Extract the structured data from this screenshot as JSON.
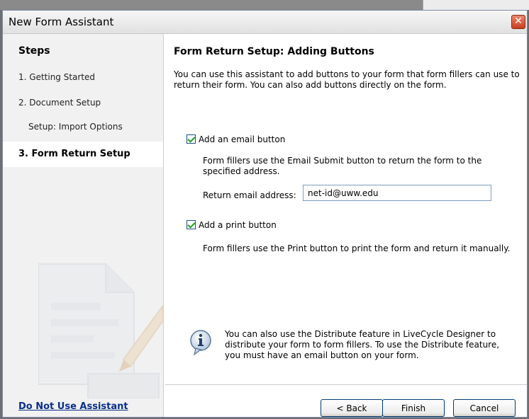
{
  "window": {
    "title": "New Form Assistant",
    "close_glyph": "✕"
  },
  "sidebar": {
    "heading": "Steps",
    "items": [
      {
        "label": "1. Getting Started"
      },
      {
        "label": "2. Document Setup"
      },
      {
        "label": "Setup: Import Options"
      },
      {
        "label": "3. Form Return Setup",
        "active": true
      }
    ],
    "footer_link": "Do Not Use Assistant"
  },
  "main": {
    "title": "Form Return Setup: Adding Buttons",
    "intro": "You can use this assistant to add buttons to your form that form fillers can use to return their form. You can also add buttons directly on the form.",
    "email_option": {
      "label": "Add an email button",
      "checked": true,
      "description": "Form fillers use the Email Submit button to return the form to the specified address.",
      "field_label": "Return email address:",
      "field_value": "net-id@uww.edu"
    },
    "print_option": {
      "label": "Add a print button",
      "checked": true,
      "description": "Form fillers use the Print button to print the form and return it manually."
    },
    "info_text": "You can also use the Distribute feature in LiveCycle Designer to distribute your form to form fillers. To use the Distribute feature, you must have an email button on your form."
  },
  "buttons": {
    "back": "< Back",
    "finish": "Finish",
    "cancel": "Cancel"
  }
}
